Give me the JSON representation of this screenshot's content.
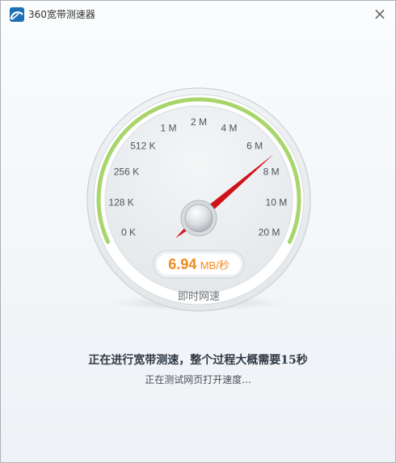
{
  "window": {
    "title": "360宽带测速器"
  },
  "gauge": {
    "ticks": [
      "0 K",
      "128 K",
      "256 K",
      "512 K",
      "1 M",
      "2 M",
      "4 M",
      "6 M",
      "8 M",
      "10 M",
      "20 M"
    ],
    "current_index": 7.15,
    "reading_value": "6.94",
    "reading_unit": "MB/秒",
    "caption": "即时网速"
  },
  "status": {
    "main": "正在进行宽带测速，整个过程大概需要15秒",
    "sub": "正在测试网页打开速度..."
  },
  "colors": {
    "needle": "#d0121b",
    "arc": "#a8d56c",
    "reading": "#f08a1e"
  }
}
